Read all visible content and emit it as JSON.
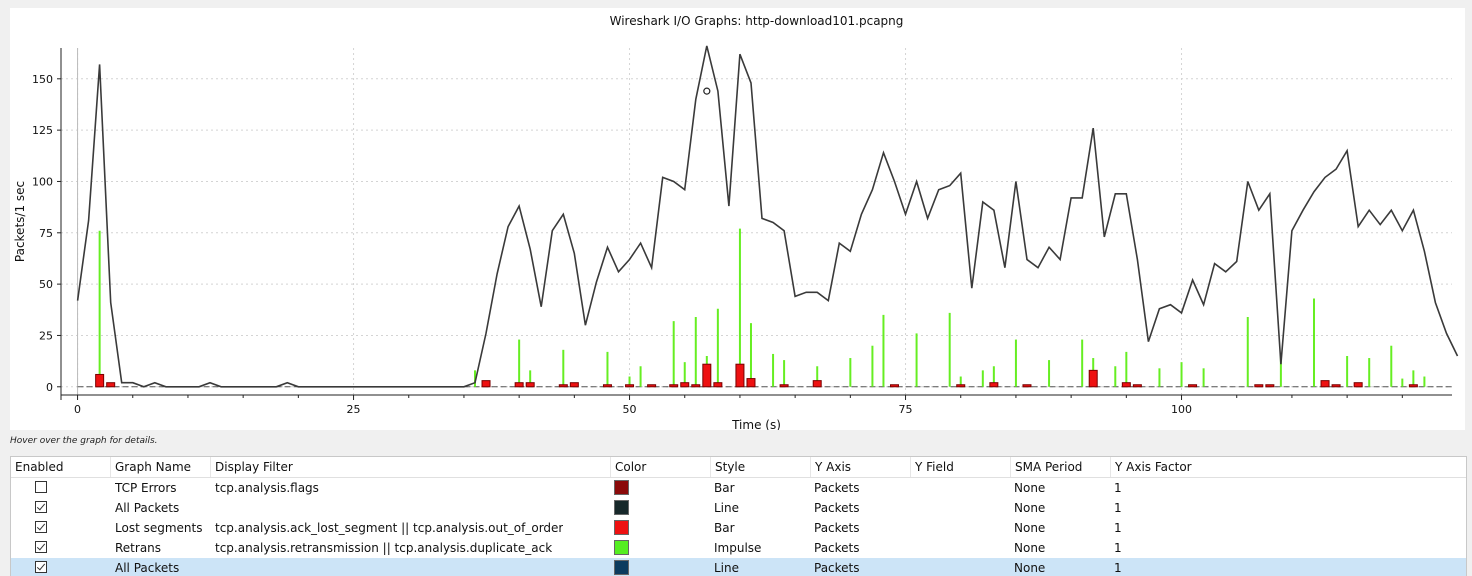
{
  "graph": {
    "title": "Wireshark I/O Graphs: http-download101.pcapng",
    "hover_hint": "Hover over the graph for details."
  },
  "chart_data": {
    "type": "line",
    "title": "Wireshark I/O Graphs: http-download101.pcapng",
    "xlabel": "Time (s)",
    "ylabel": "Packets/1 sec",
    "xlim": [
      -1.5,
      124.5
    ],
    "ylim": [
      -4,
      165
    ],
    "x_ticks": [
      0,
      25,
      50,
      75,
      100
    ],
    "y_ticks": [
      0,
      25,
      50,
      75,
      100,
      125,
      150
    ],
    "grid": true,
    "series": [
      {
        "name": "All Packets",
        "style": "line",
        "color": "#3a3a3a",
        "values": [
          42,
          81,
          157,
          41,
          2,
          2,
          0,
          2,
          0,
          0,
          0,
          0,
          2,
          0,
          0,
          0,
          0,
          0,
          0,
          2,
          0,
          0,
          0,
          0,
          0,
          0,
          0,
          0,
          0,
          0,
          0,
          0,
          0,
          0,
          0,
          0,
          2,
          26,
          55,
          78,
          88,
          67,
          39,
          76,
          84,
          65,
          30,
          51,
          68,
          56,
          62,
          70,
          58,
          102,
          100,
          96,
          140,
          166,
          144,
          88,
          162,
          148,
          82,
          80,
          76,
          44,
          46,
          46,
          42,
          70,
          66,
          84,
          96,
          114,
          100,
          84,
          100,
          82,
          96,
          98,
          104,
          48,
          90,
          86,
          58,
          100,
          62,
          58,
          68,
          62,
          92,
          92,
          126,
          73,
          94,
          94,
          62,
          22,
          38,
          40,
          36,
          52,
          40,
          60,
          56,
          61,
          100,
          86,
          94,
          11,
          76,
          86,
          95,
          102,
          106,
          115,
          78,
          86,
          79,
          86,
          76,
          86,
          66,
          41,
          26,
          15
        ]
      },
      {
        "name": "Retrans",
        "style": "impulse",
        "color": "#66ee22",
        "points": [
          [
            2,
            76
          ],
          [
            36,
            8
          ],
          [
            40,
            23
          ],
          [
            41,
            8
          ],
          [
            44,
            18
          ],
          [
            48,
            17
          ],
          [
            50,
            5
          ],
          [
            51,
            10
          ],
          [
            54,
            32
          ],
          [
            55,
            12
          ],
          [
            56,
            34
          ],
          [
            57,
            15
          ],
          [
            58,
            38
          ],
          [
            60,
            77
          ],
          [
            61,
            31
          ],
          [
            63,
            16
          ],
          [
            64,
            13
          ],
          [
            67,
            10
          ],
          [
            70,
            14
          ],
          [
            72,
            20
          ],
          [
            73,
            35
          ],
          [
            76,
            26
          ],
          [
            79,
            36
          ],
          [
            80,
            5
          ],
          [
            82,
            8
          ],
          [
            83,
            10
          ],
          [
            85,
            23
          ],
          [
            88,
            13
          ],
          [
            91,
            23
          ],
          [
            92,
            14
          ],
          [
            94,
            10
          ],
          [
            95,
            17
          ],
          [
            98,
            9
          ],
          [
            100,
            12
          ],
          [
            102,
            9
          ],
          [
            106,
            34
          ],
          [
            109,
            16
          ],
          [
            112,
            43
          ],
          [
            115,
            15
          ],
          [
            117,
            14
          ],
          [
            119,
            20
          ],
          [
            120,
            4
          ],
          [
            121,
            8
          ],
          [
            122,
            5
          ]
        ]
      },
      {
        "name": "Lost segments",
        "style": "bar",
        "color": "#ee1111",
        "points": [
          [
            2,
            6
          ],
          [
            3,
            2
          ],
          [
            37,
            3
          ],
          [
            40,
            2
          ],
          [
            41,
            2
          ],
          [
            44,
            1
          ],
          [
            45,
            2
          ],
          [
            48,
            1
          ],
          [
            50,
            1
          ],
          [
            52,
            1
          ],
          [
            54,
            1
          ],
          [
            55,
            2
          ],
          [
            56,
            1
          ],
          [
            57,
            11
          ],
          [
            58,
            2
          ],
          [
            60,
            11
          ],
          [
            61,
            4
          ],
          [
            64,
            1
          ],
          [
            67,
            3
          ],
          [
            74,
            1
          ],
          [
            80,
            1
          ],
          [
            83,
            2
          ],
          [
            86,
            1
          ],
          [
            92,
            8
          ],
          [
            95,
            2
          ],
          [
            96,
            1
          ],
          [
            101,
            1
          ],
          [
            107,
            1
          ],
          [
            108,
            1
          ],
          [
            113,
            3
          ],
          [
            114,
            1
          ],
          [
            116,
            2
          ],
          [
            121,
            1
          ]
        ]
      }
    ]
  },
  "table": {
    "columns": [
      "Enabled",
      "Graph Name",
      "Display Filter",
      "Color",
      "Style",
      "Y Axis",
      "Y Field",
      "SMA Period",
      "Y Axis Factor"
    ],
    "rows": [
      {
        "enabled": false,
        "name": "TCP Errors",
        "filter": "tcp.analysis.flags",
        "color": "#8b0a0a",
        "style": "Bar",
        "y_axis": "Packets",
        "y_field": "",
        "sma": "None",
        "factor": "1"
      },
      {
        "enabled": true,
        "name": "All Packets",
        "filter": "",
        "color": "#17282a",
        "style": "Line",
        "y_axis": "Packets",
        "y_field": "",
        "sma": "None",
        "factor": "1"
      },
      {
        "enabled": true,
        "name": "Lost segments",
        "filter": "tcp.analysis.ack_lost_segment || tcp.analysis.out_of_order",
        "color": "#ee1111",
        "style": "Bar",
        "y_axis": "Packets",
        "y_field": "",
        "sma": "None",
        "factor": "1"
      },
      {
        "enabled": true,
        "name": "Retrans",
        "filter": "tcp.analysis.retransmission || tcp.analysis.duplicate_ack",
        "color": "#55ee22",
        "style": "Impulse",
        "y_axis": "Packets",
        "y_field": "",
        "sma": "None",
        "factor": "1"
      },
      {
        "enabled": true,
        "name": "All Packets",
        "filter": "",
        "color": "#0c3b5e",
        "style": "Line",
        "y_axis": "Packets",
        "y_field": "",
        "sma": "None",
        "factor": "1",
        "selected": true
      }
    ]
  }
}
